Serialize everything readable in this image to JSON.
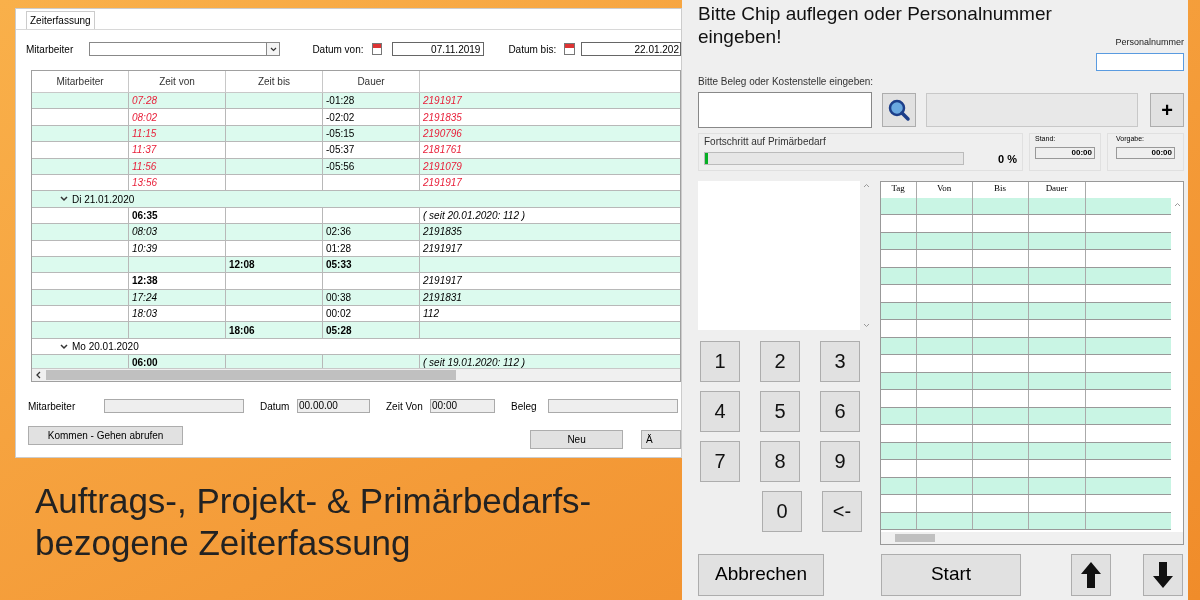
{
  "time_window": {
    "tab": {
      "label": "Zeiterfassung",
      "selected": true
    },
    "filters": {
      "employee_label": "Mitarbeiter",
      "date_from_label": "Datum von:",
      "date_from": "07.11.2019",
      "date_to_label": "Datum bis:",
      "date_to": "22.01.202"
    },
    "table": {
      "columns": [
        "Mitarbeiter",
        "Zeit von",
        "Zeit bis",
        "Dauer"
      ],
      "rows": [
        {
          "kind": "error",
          "zeit_von": "07:28",
          "dauer": "-01:28",
          "beleg": "2191917"
        },
        {
          "kind": "error",
          "zeit_von": "08:02",
          "dauer": "-02:02",
          "beleg": "2191835"
        },
        {
          "kind": "error",
          "zeit_von": "11:15",
          "dauer": "-05:15",
          "beleg": "2190796"
        },
        {
          "kind": "error",
          "zeit_von": "11:37",
          "dauer": "-05:37",
          "beleg": "2181761"
        },
        {
          "kind": "error",
          "zeit_von": "11:56",
          "dauer": "-05:56",
          "beleg": "2191079"
        },
        {
          "kind": "error",
          "zeit_von": "13:56",
          "beleg": "2191917"
        },
        {
          "kind": "group",
          "label": "Di 21.01.2020",
          "expanded": true
        },
        {
          "kind": "clock_in",
          "zeit_von": "06:35",
          "beleg": "( seit 20.01.2020: 112 )"
        },
        {
          "kind": "booking",
          "zeit_von": "08:03",
          "dauer": "02:36",
          "beleg": "2191835"
        },
        {
          "kind": "booking",
          "zeit_von": "10:39",
          "dauer": "01:28",
          "beleg": "2191917"
        },
        {
          "kind": "clock_out",
          "zeit_bis": "12:08",
          "dauer": "05:33"
        },
        {
          "kind": "clock_in",
          "zeit_von": "12:38",
          "beleg": "2191917"
        },
        {
          "kind": "booking",
          "zeit_von": "17:24",
          "dauer": "00:38",
          "beleg": "2191831"
        },
        {
          "kind": "booking",
          "zeit_von": "18:03",
          "dauer": "00:02",
          "beleg": "112"
        },
        {
          "kind": "clock_out",
          "zeit_bis": "18:06",
          "dauer": "05:28"
        },
        {
          "kind": "group",
          "label": "Mo 20.01.2020",
          "expanded": true
        },
        {
          "kind": "clock_in",
          "zeit_von": "06:00",
          "beleg": "( seit 19.01.2020: 112 )"
        }
      ]
    },
    "form": {
      "employee_label": "Mitarbeiter",
      "date_label": "Datum",
      "date_value": "00.00.00",
      "time_label": "Zeit Von",
      "time_value": "00:00",
      "beleg_label": "Beleg"
    },
    "buttons": {
      "fetch": "Kommen - Gehen abrufen",
      "new": "Neu",
      "cut": "Ä"
    }
  },
  "terminal": {
    "prompt": "Bitte Chip auflegen oder Personalnummer eingeben!",
    "personnel_label": "Personalnummer",
    "beleg_label": "Bitte Beleg oder Kostenstelle eingeben:",
    "plus": "+",
    "progress": {
      "label": "Fortschritt auf Primärbedarf",
      "level": 0.01,
      "percent": "0 %",
      "stand_label": "Stand:",
      "stand": "00:00",
      "vorgabe_label": "Vorgabe:",
      "vorgabe": "00:00"
    },
    "keypad": [
      {
        "kind": "full",
        "keys": [
          "1",
          "2",
          "3"
        ]
      },
      {
        "kind": "full",
        "keys": [
          "4",
          "5",
          "6"
        ]
      },
      {
        "kind": "full",
        "keys": [
          "7",
          "8",
          "9"
        ]
      },
      {
        "kind": "offset",
        "keys": [
          "0",
          "<-"
        ]
      }
    ],
    "table_columns": [
      "Tag",
      "Von",
      "Bis",
      "Dauer"
    ],
    "buttons": {
      "cancel": "Abbrechen",
      "start": "Start"
    }
  },
  "caption": [
    "Auftrags-, Projekt- & Primärbedarfs-",
    "bezogene Zeiterfassung"
  ]
}
